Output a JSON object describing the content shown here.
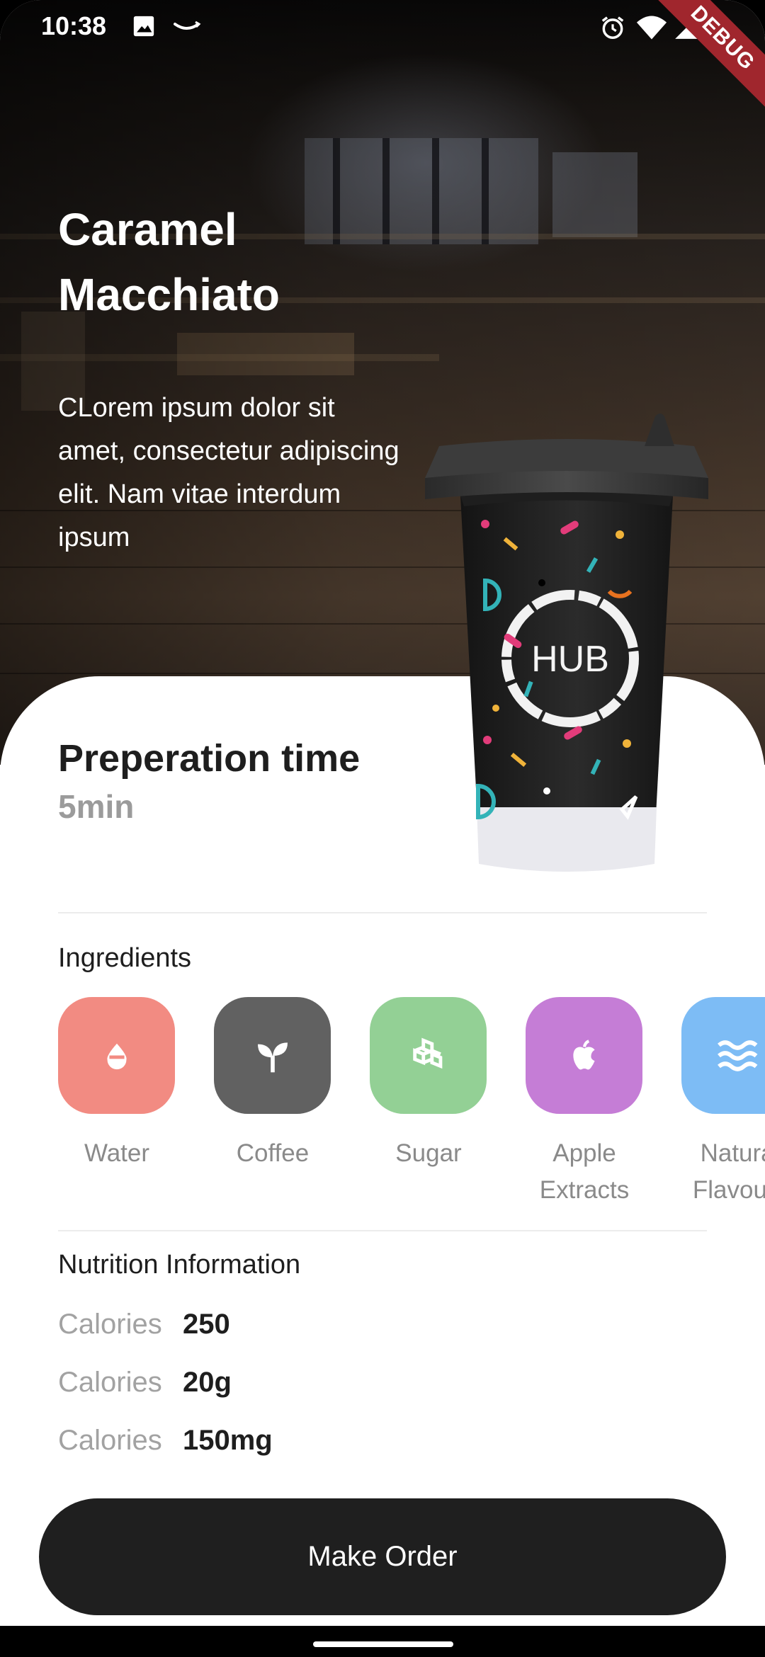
{
  "status_bar": {
    "time": "10:38",
    "left_icons": [
      "image-icon",
      "amazon-smile-icon"
    ],
    "right_icons": [
      "alarm-icon",
      "wifi-icon",
      "signal-icon",
      "battery-icon"
    ]
  },
  "debug_banner": "DEBUG",
  "product": {
    "title": "Caramel Macchiato",
    "description": "CLorem ipsum dolor sit amet, consectetur adipiscing elit. Nam vitae interdum ipsum",
    "cup_print": "HUB"
  },
  "preparation": {
    "label": "Preperation time",
    "value": "5min"
  },
  "ingredients": {
    "title": "Ingredients",
    "items": [
      {
        "label": "Water",
        "icon": "water-drop-icon",
        "color": "#f28b82"
      },
      {
        "label": "Coffee",
        "icon": "sprout-icon",
        "color": "#616161"
      },
      {
        "label": "Sugar",
        "icon": "sugar-cubes-icon",
        "color": "#93d095"
      },
      {
        "label": "Apple Extracts",
        "icon": "apple-icon",
        "color": "#c57dd6"
      },
      {
        "label": "Natural Flavours",
        "icon": "waves-icon",
        "color": "#7dbcf5"
      }
    ]
  },
  "nutrition": {
    "title": "Nutrition Information",
    "rows": [
      {
        "label": "Calories",
        "value": "250"
      },
      {
        "label": "Calories",
        "value": "20g"
      },
      {
        "label": "Calories",
        "value": "150mg"
      }
    ]
  },
  "order_button": "Make Order",
  "colors": {
    "button_bg": "#1f1f1f",
    "muted_text": "#9b9b9b",
    "debug_banner": "#a0262d"
  }
}
